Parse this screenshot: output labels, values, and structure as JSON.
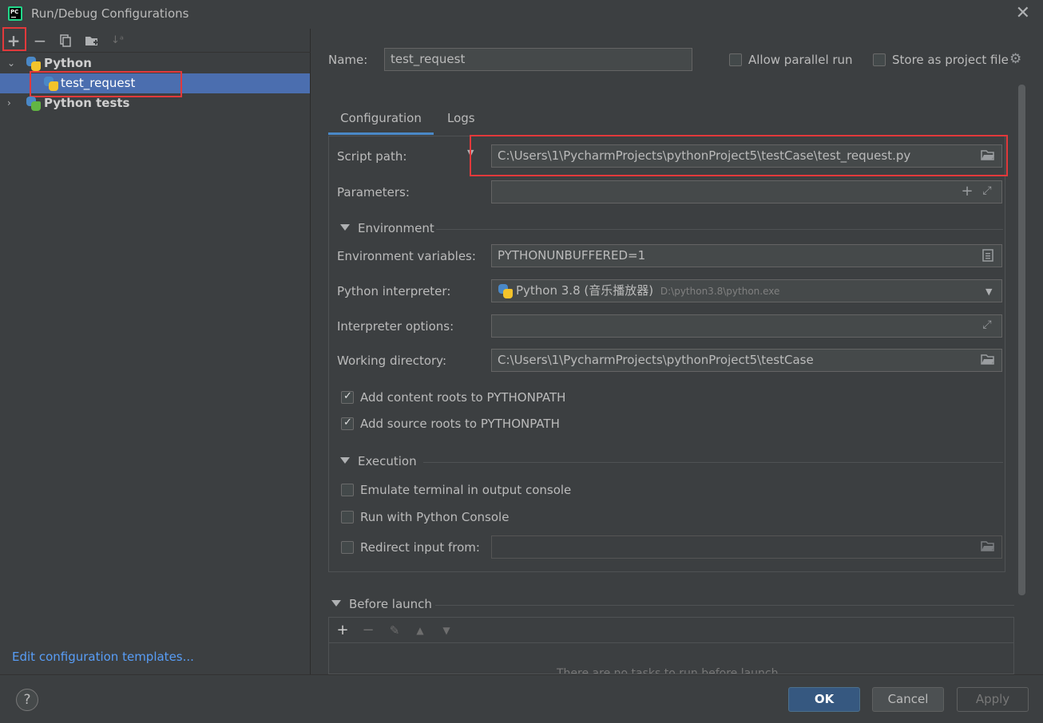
{
  "window": {
    "title": "Run/Debug Configurations",
    "app_icon_text": "PC"
  },
  "left": {
    "toolbar": {
      "add": "+",
      "remove": "−",
      "copy": "copy-icon",
      "folder": "new-folder-icon",
      "sort": "sort-icon"
    },
    "tree": [
      {
        "label": "Python",
        "expanded": true,
        "bold": true
      },
      {
        "label": "test_request",
        "selected": true
      },
      {
        "label": "Python tests",
        "expanded": false,
        "bold": true
      }
    ],
    "edit_templates": "Edit configuration templates..."
  },
  "form": {
    "name_label": "Name:",
    "name_value": "test_request",
    "allow_parallel": "Allow parallel run",
    "store_project": "Store as project file",
    "tabs": [
      "Configuration",
      "Logs"
    ],
    "script_path_label": "Script path:",
    "script_path_value": "C:\\Users\\1\\PycharmProjects\\pythonProject5\\testCase\\test_request.py",
    "parameters_label": "Parameters:",
    "parameters_value": "",
    "environment_section": "Environment",
    "env_vars_label": "Environment variables:",
    "env_vars_value": "PYTHONUNBUFFERED=1",
    "interpreter_label": "Python interpreter:",
    "interpreter_value": "Python 3.8 (音乐播放器)",
    "interpreter_path": "D:\\python3.8\\python.exe",
    "interp_options_label": "Interpreter options:",
    "interp_options_value": "",
    "working_dir_label": "Working directory:",
    "working_dir_value": "C:\\Users\\1\\PycharmProjects\\pythonProject5\\testCase",
    "add_content_roots": "Add content roots to PYTHONPATH",
    "add_source_roots": "Add source roots to PYTHONPATH",
    "execution_section": "Execution",
    "emulate_terminal": "Emulate terminal in output console",
    "run_python_console": "Run with Python Console",
    "redirect_input": "Redirect input from:",
    "redirect_value": "",
    "before_launch": "Before launch",
    "before_launch_empty": "There are no tasks to run before launch"
  },
  "buttons": {
    "help": "?",
    "ok": "OK",
    "cancel": "Cancel",
    "apply": "Apply"
  },
  "colors": {
    "background": "#3c3f41",
    "selection": "#4b6eaf",
    "highlight_box": "#e2393b",
    "link": "#589df6",
    "primary_button": "#365880"
  }
}
